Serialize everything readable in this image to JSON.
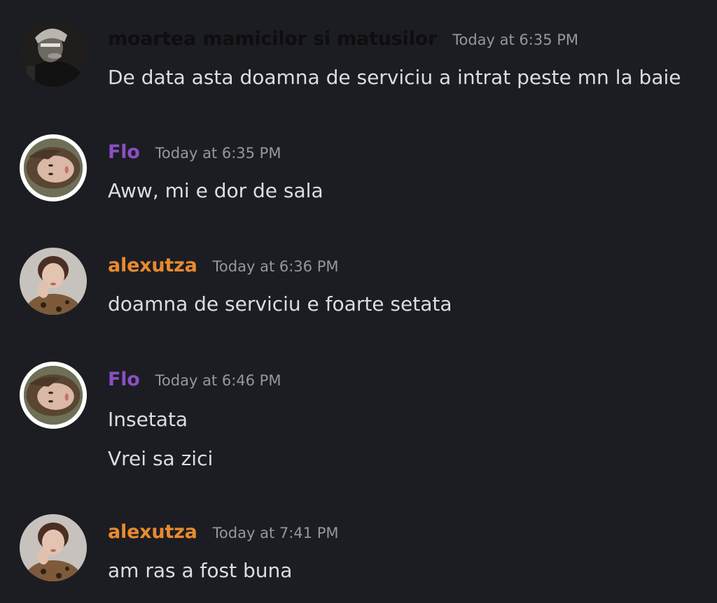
{
  "colors": {
    "background": "#1c1d22",
    "message_text": "#dcdde1",
    "timestamp": "#9597a0"
  },
  "messages": [
    {
      "author": "moartea mamicilor si matusilor",
      "author_color": "#0e0e10",
      "timestamp": "Today at 6:35 PM",
      "lines": [
        "De data asta doamna de serviciu a intrat peste mn la baie"
      ]
    },
    {
      "author": "Flo",
      "author_color": "#8b4fc4",
      "timestamp": "Today at 6:35 PM",
      "lines": [
        "Aww, mi e dor de sala"
      ]
    },
    {
      "author": "alexutza",
      "author_color": "#e88a2f",
      "timestamp": "Today at 6:36 PM",
      "lines": [
        "doamna de serviciu e foarte setata"
      ]
    },
    {
      "author": "Flo",
      "author_color": "#8b4fc4",
      "timestamp": "Today at 6:46 PM",
      "lines": [
        "Insetata",
        "Vrei sa zici"
      ]
    },
    {
      "author": "alexutza",
      "author_color": "#e88a2f",
      "timestamp": "Today at 7:41 PM",
      "lines": [
        "am ras a fost buna"
      ]
    }
  ]
}
